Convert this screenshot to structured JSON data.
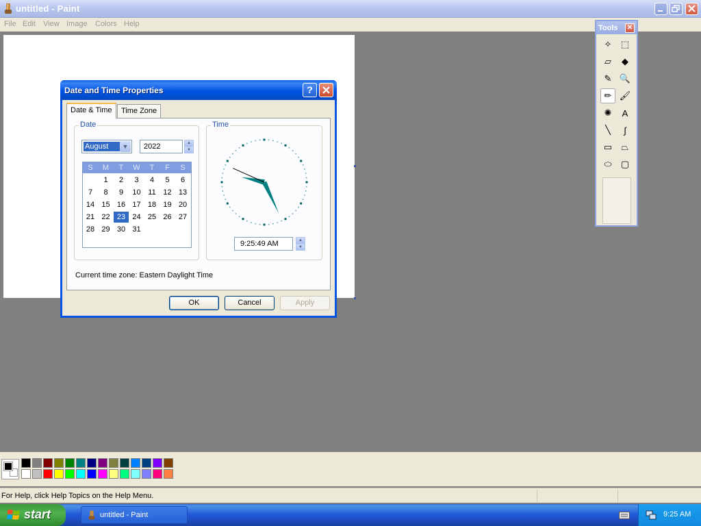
{
  "window": {
    "title": "untitled - Paint",
    "controls": [
      "minimize",
      "restore",
      "close"
    ]
  },
  "menu": [
    "File",
    "Edit",
    "View",
    "Image",
    "Colors",
    "Help"
  ],
  "tools_window": {
    "title": "Tools",
    "close_glyph": "✕",
    "tools": [
      {
        "name": "free-form-select-icon",
        "glyph": "✧"
      },
      {
        "name": "select-icon",
        "glyph": "⬚"
      },
      {
        "name": "eraser-icon",
        "glyph": "▱"
      },
      {
        "name": "fill-with-color-icon",
        "glyph": "◆"
      },
      {
        "name": "pick-color-icon",
        "glyph": "✎"
      },
      {
        "name": "magnifier-icon",
        "glyph": "🔍"
      },
      {
        "name": "pencil-icon",
        "glyph": "✏"
      },
      {
        "name": "brush-icon",
        "glyph": "🖌"
      },
      {
        "name": "airbrush-icon",
        "glyph": "✺"
      },
      {
        "name": "text-icon",
        "glyph": "A"
      },
      {
        "name": "line-icon",
        "glyph": "╲"
      },
      {
        "name": "curve-icon",
        "glyph": "∫"
      },
      {
        "name": "rectangle-icon",
        "glyph": "▭"
      },
      {
        "name": "polygon-icon",
        "glyph": "⏢"
      },
      {
        "name": "ellipse-icon",
        "glyph": "⬭"
      },
      {
        "name": "rounded-rectangle-icon",
        "glyph": "▢"
      }
    ],
    "active_tool": "pencil-icon"
  },
  "palette": {
    "foreground": "#000000",
    "background": "#ffffff",
    "top_row": [
      "#000000",
      "#808080",
      "#800000",
      "#808000",
      "#008000",
      "#008080",
      "#000080",
      "#800080",
      "#808040",
      "#004040",
      "#0080ff",
      "#004080",
      "#8000ff",
      "#804000"
    ],
    "bottom_row": [
      "#ffffff",
      "#c0c0c0",
      "#ff0000",
      "#ffff00",
      "#00ff00",
      "#00ffff",
      "#0000ff",
      "#ff00ff",
      "#ffff80",
      "#00ff80",
      "#80ffff",
      "#8080ff",
      "#ff0080",
      "#ff8040"
    ]
  },
  "status": {
    "help_text": "For Help, click Help Topics on the Help Menu."
  },
  "taskbar": {
    "start_label": "start",
    "task_label": "untitled - Paint",
    "clock": "9:25 AM"
  },
  "dialog": {
    "title": "Date and Time Properties",
    "help_glyph": "?",
    "tabs": [
      "Date & Time",
      "Time Zone"
    ],
    "active_tab": "Date & Time",
    "date_group_label": "Date",
    "time_group_label": "Time",
    "month": "August",
    "year": "2022",
    "weekday_headers": [
      "S",
      "M",
      "T",
      "W",
      "T",
      "F",
      "S"
    ],
    "first_weekday_index": 1,
    "days_in_month": 31,
    "selected_day": 23,
    "time_value": "9:25:49 AM",
    "clock_hands": {
      "hour": 9,
      "minute": 25,
      "second": 49
    },
    "timezone_text": "Current time zone:  Eastern Daylight Time",
    "buttons": {
      "ok": "OK",
      "cancel": "Cancel",
      "apply": "Apply"
    }
  },
  "colors": {
    "title_accent": "#0054e3",
    "selection": "#316ac5",
    "clock_hand": "#008080"
  }
}
